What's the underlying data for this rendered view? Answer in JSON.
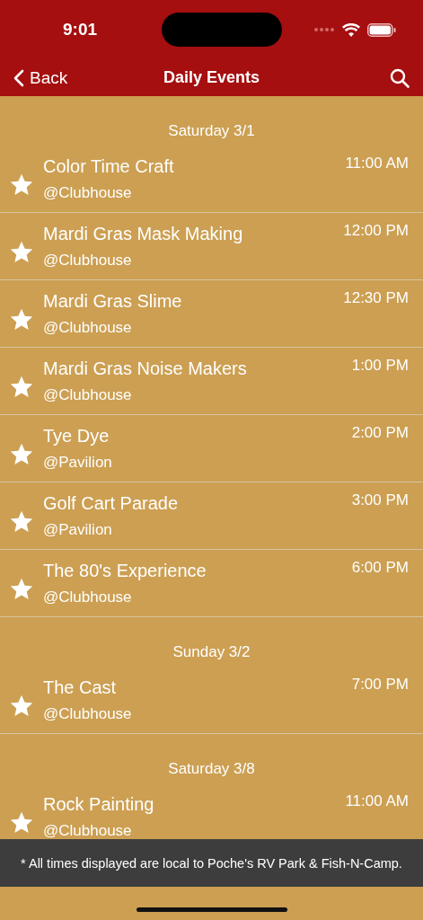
{
  "status_bar": {
    "time": "9:01"
  },
  "nav": {
    "back": "Back",
    "title": "Daily Events"
  },
  "sections": [
    {
      "date": "Saturday 3/1",
      "events": [
        {
          "title": "Color Time Craft",
          "location": "@Clubhouse",
          "time": "11:00 AM"
        },
        {
          "title": "Mardi Gras Mask Making",
          "location": "@Clubhouse",
          "time": "12:00 PM"
        },
        {
          "title": "Mardi Gras Slime",
          "location": "@Clubhouse",
          "time": "12:30 PM"
        },
        {
          "title": "Mardi Gras Noise Makers",
          "location": "@Clubhouse",
          "time": "1:00 PM"
        },
        {
          "title": "Tye Dye",
          "location": "@Pavilion",
          "time": "2:00 PM"
        },
        {
          "title": "Golf Cart Parade",
          "location": "@Pavilion",
          "time": "3:00 PM"
        },
        {
          "title": "The 80's Experience",
          "location": "@Clubhouse",
          "time": "6:00 PM"
        }
      ]
    },
    {
      "date": "Sunday 3/2",
      "events": [
        {
          "title": "The Cast",
          "location": "@Clubhouse",
          "time": "7:00 PM"
        }
      ]
    },
    {
      "date": "Saturday 3/8",
      "events": [
        {
          "title": "Rock Painting",
          "location": "@Clubhouse",
          "time": "11:00 AM"
        }
      ]
    }
  ],
  "footer": "* All times displayed are local to Poche's RV Park & Fish-N-Camp."
}
